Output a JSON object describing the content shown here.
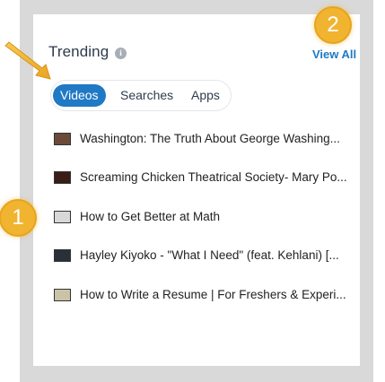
{
  "header": {
    "title": "Trending",
    "view_all_label": "View All"
  },
  "tabs": [
    {
      "label": "Videos",
      "active": true
    },
    {
      "label": "Searches",
      "active": false
    },
    {
      "label": "Apps",
      "active": false
    }
  ],
  "items": [
    {
      "title": "Washington: The Truth About George Washing...",
      "thumb_color": "#6b4a3a"
    },
    {
      "title": "Screaming Chicken Theatrical Society- Mary Po...",
      "thumb_color": "#3a1d14"
    },
    {
      "title": "How to Get Better at Math",
      "thumb_color": "#d8d8d8"
    },
    {
      "title": "Hayley Kiyoko - \"What I Need\" (feat. Kehlani) [...",
      "thumb_color": "#2a2f3a"
    },
    {
      "title": "How to Write a Resume | For Freshers & Experi...",
      "thumb_color": "#c9c4a8"
    }
  ],
  "callouts": [
    {
      "label": "1"
    },
    {
      "label": "2"
    }
  ],
  "colors": {
    "accent": "#1f79c4",
    "callout": "#f1b430",
    "frame": "#d9d9d9"
  }
}
